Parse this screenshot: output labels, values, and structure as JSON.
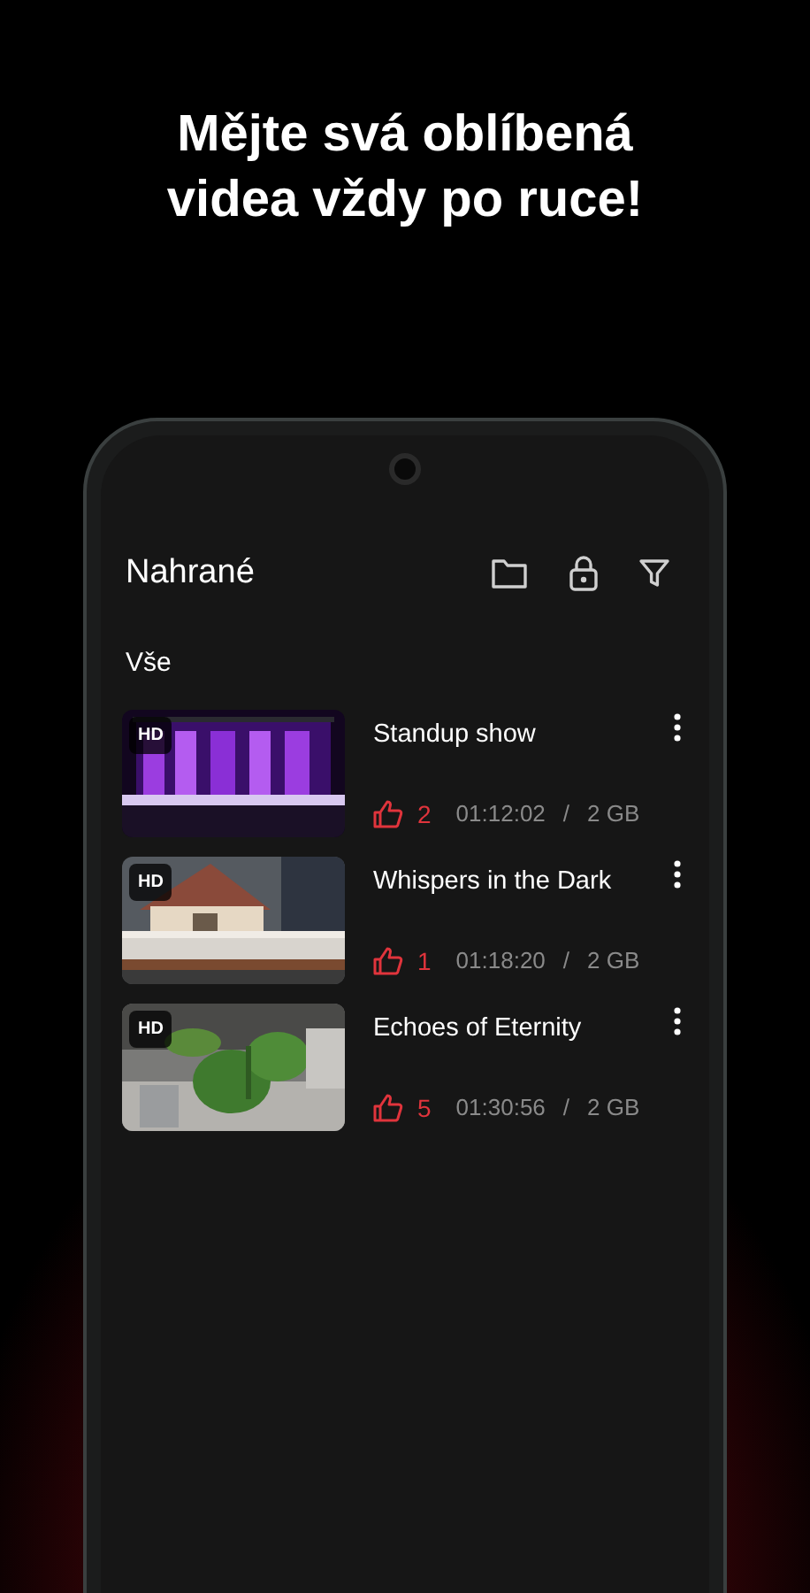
{
  "headline": "Mějte svá oblíbená videa vždy po ruce!",
  "app_bar": {
    "title": "Nahrané"
  },
  "section": "Vše",
  "videos": [
    {
      "title": "Standup show",
      "badge": "HD",
      "likes": "2",
      "duration": "01:12:02",
      "separator": "/",
      "size": "2 GB"
    },
    {
      "title": "Whispers in the Dark",
      "badge": "HD",
      "likes": "1",
      "duration": "01:18:20",
      "separator": "/",
      "size": "2 GB"
    },
    {
      "title": "Echoes of Eternity",
      "badge": "HD",
      "likes": "5",
      "duration": "01:30:56",
      "separator": "/",
      "size": "2 GB"
    }
  ]
}
